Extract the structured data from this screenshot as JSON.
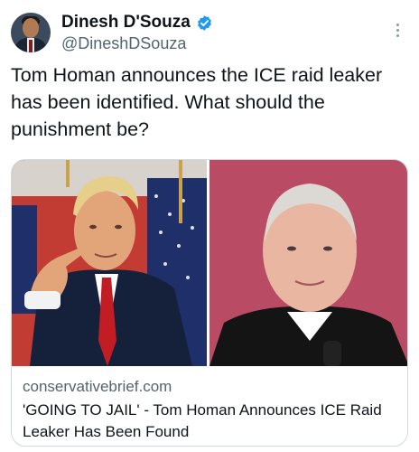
{
  "author": {
    "display_name": "Dinesh D'Souza",
    "handle": "@DineshDSouza",
    "verified": true,
    "avatar_icon": "profile-photo"
  },
  "tweet": {
    "text": "Tom Homan announces the ICE raid leaker has been identified. What should the punishment be?"
  },
  "card": {
    "domain": "conservativebrief.com",
    "title": "'GOING TO JAIL' - Tom Homan Announces ICE Raid Leaker Has Been Found",
    "image_left": "photo-man-pointing",
    "image_right": "photo-man-portrait"
  },
  "colors": {
    "verified_badge": "#1d9bf0",
    "secondary_text": "#536471",
    "border": "#cfd9de"
  }
}
